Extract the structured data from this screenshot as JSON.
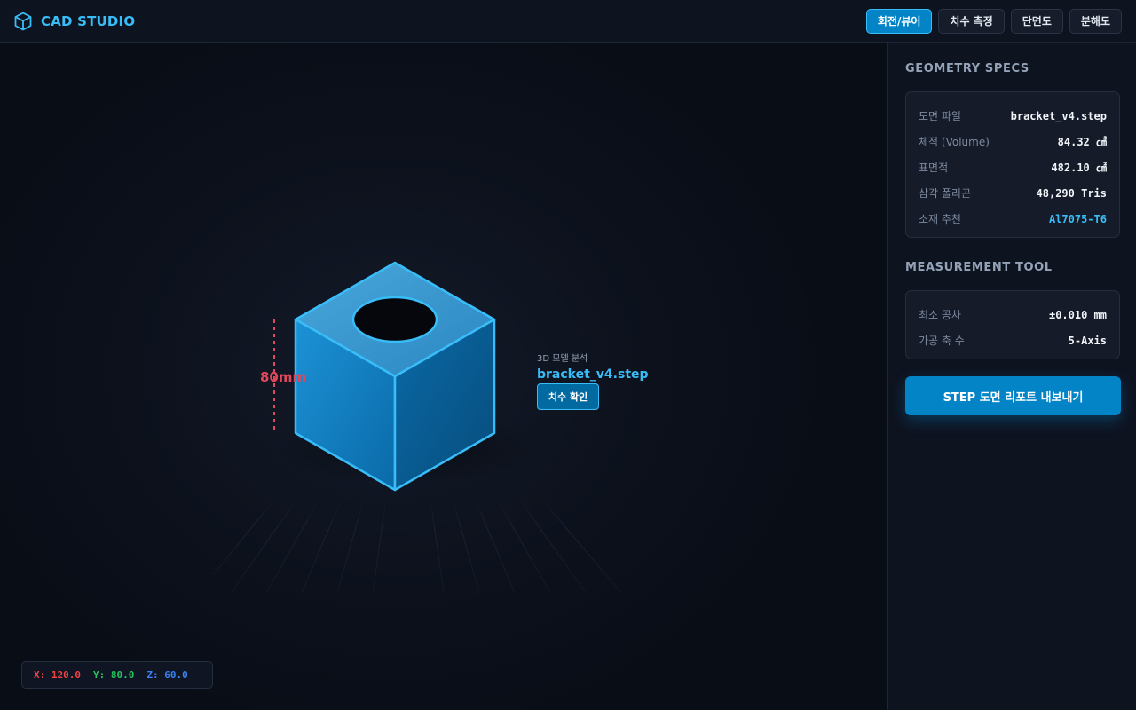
{
  "header": {
    "brand_title": "CAD STUDIO",
    "brand_icon": "cube-icon",
    "tools": [
      {
        "label": "회전/뷰어",
        "active": true
      },
      {
        "label": "치수 측정",
        "active": false
      },
      {
        "label": "단면도",
        "active": false
      },
      {
        "label": "분해도",
        "active": false
      }
    ]
  },
  "viewport": {
    "dimension_label": "80mm",
    "model_caption": "3D 모델 분석",
    "model_name": "bracket_v4.step",
    "check_button": "치수 확인",
    "coords": {
      "x": "X: 120.0",
      "y": "Y: 80.0",
      "z": "Z: 60.0"
    }
  },
  "sidebar": {
    "geometry_title": "GEOMETRY SPECS",
    "geometry": [
      {
        "label": "도면 파일",
        "value": "bracket_v4.step"
      },
      {
        "label": "체적 (Volume)",
        "value": "84.32 ㎤"
      },
      {
        "label": "표면적",
        "value": "482.10 ㎠"
      },
      {
        "label": "삼각 폴리곤",
        "value": "48,290 Tris"
      },
      {
        "label": "소재 추천",
        "value": "Al7075-T6"
      }
    ],
    "measurement_title": "MEASUREMENT TOOL",
    "measurement": [
      {
        "label": "최소 공차",
        "value": "±0.010 mm"
      },
      {
        "label": "가공 축 수",
        "value": "5-Axis"
      }
    ],
    "export_button": "STEP 도면 리포트 내보내기"
  },
  "colors": {
    "accent": "#38bdf8",
    "active_button": "#0284c7",
    "dimension": "#e0475a",
    "coord_x": "#ef4444",
    "coord_y": "#22c55e",
    "coord_z": "#3b82f6"
  }
}
